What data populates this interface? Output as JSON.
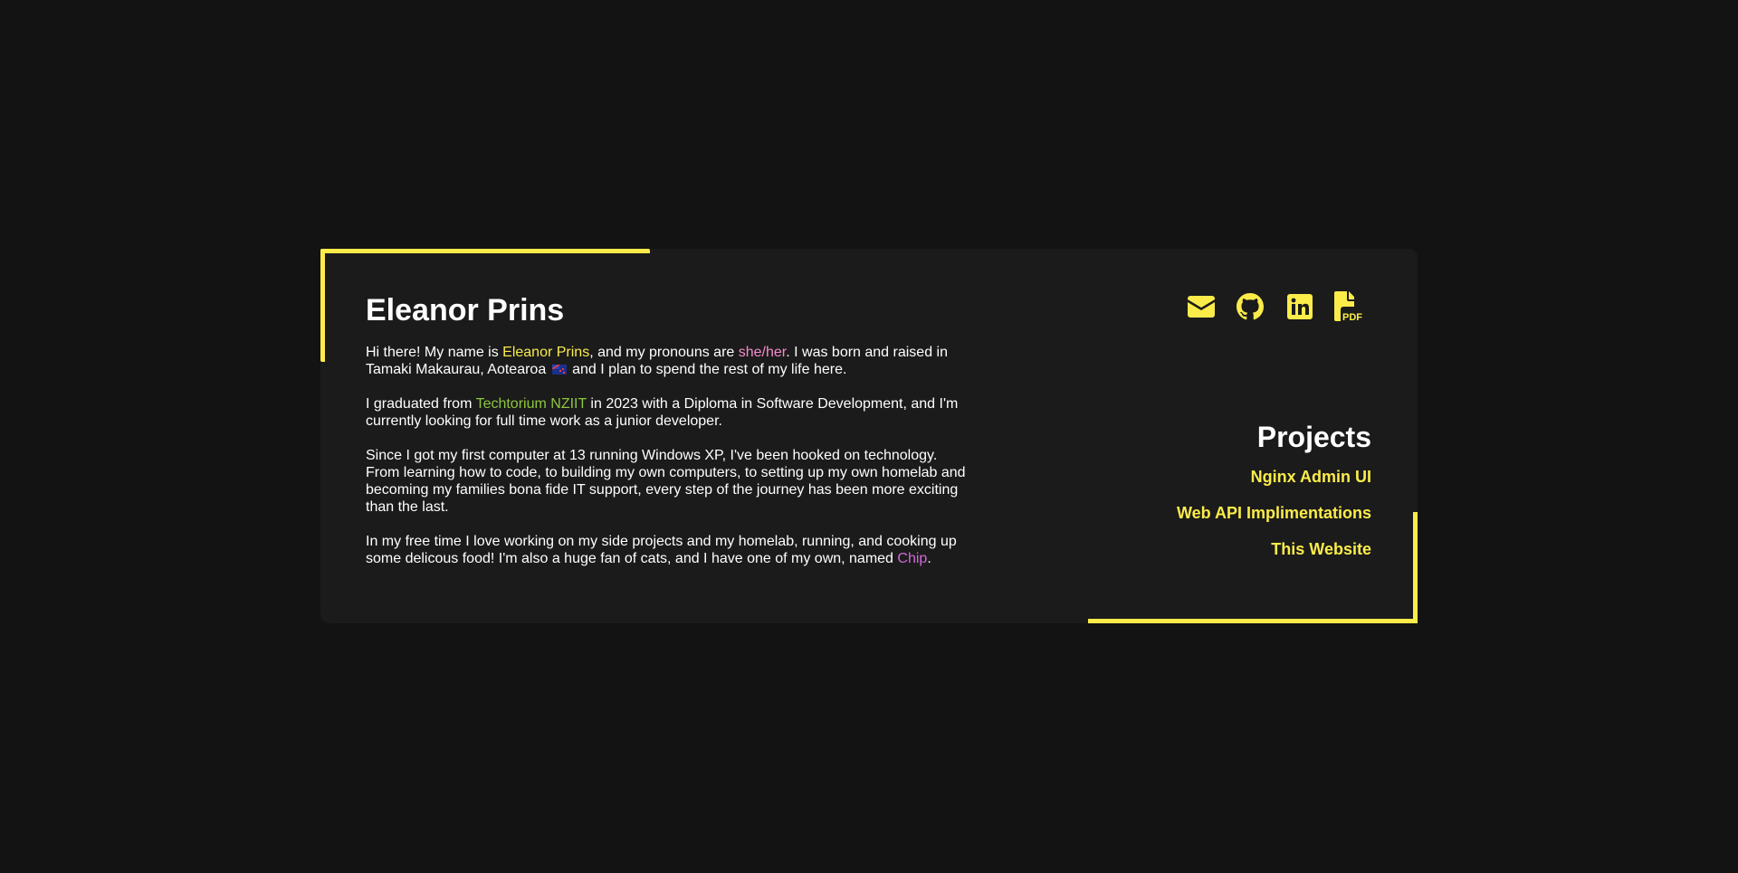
{
  "profile": {
    "name": "Eleanor Prins",
    "p1": {
      "a": "Hi there! My name is ",
      "name": "Eleanor Prins",
      "b": ", and my pronouns are ",
      "pronouns": "she/her",
      "c": ". I was born and raised in Tamaki Makaurau, Aotearoa ",
      "d": " and I plan to spend the rest of my life here."
    },
    "p2": {
      "a": "I graduated from ",
      "school": "Techtorium NZIIT",
      "b": " in 2023 with a Diploma in Software Development, and I'm currently looking for full time work as a junior developer."
    },
    "p3": "Since I got my first computer at 13 running Windows XP, I've been hooked on technology. From learning how to code, to building my own computers, to setting up my own homelab and becoming my families bona fide IT support, every step of the journey has been more exciting than the last.",
    "p4": {
      "a": "In my free time I love working on my side projects and my homelab, running, and cooking up some delicous food! I'm also a huge fan of cats, and I have one of my own, named ",
      "cat": "Chip",
      "b": "."
    }
  },
  "social": [
    {
      "icon": "envelope-icon",
      "label": "Email"
    },
    {
      "icon": "github-icon",
      "label": "GitHub"
    },
    {
      "icon": "linkedin-icon",
      "label": "LinkedIn"
    },
    {
      "icon": "pdf-file-icon",
      "label": "Resume PDF",
      "badge": "PDF"
    }
  ],
  "projects": {
    "title": "Projects",
    "items": [
      "Nginx Admin UI",
      "Web API Implimentations",
      "This Website"
    ]
  },
  "colors": {
    "background": "#131313",
    "card": "#1b1b1b",
    "accent": "#fbec4a",
    "pink": "#f58ccd",
    "green": "#8ec63f",
    "purple": "#d16ad8"
  }
}
